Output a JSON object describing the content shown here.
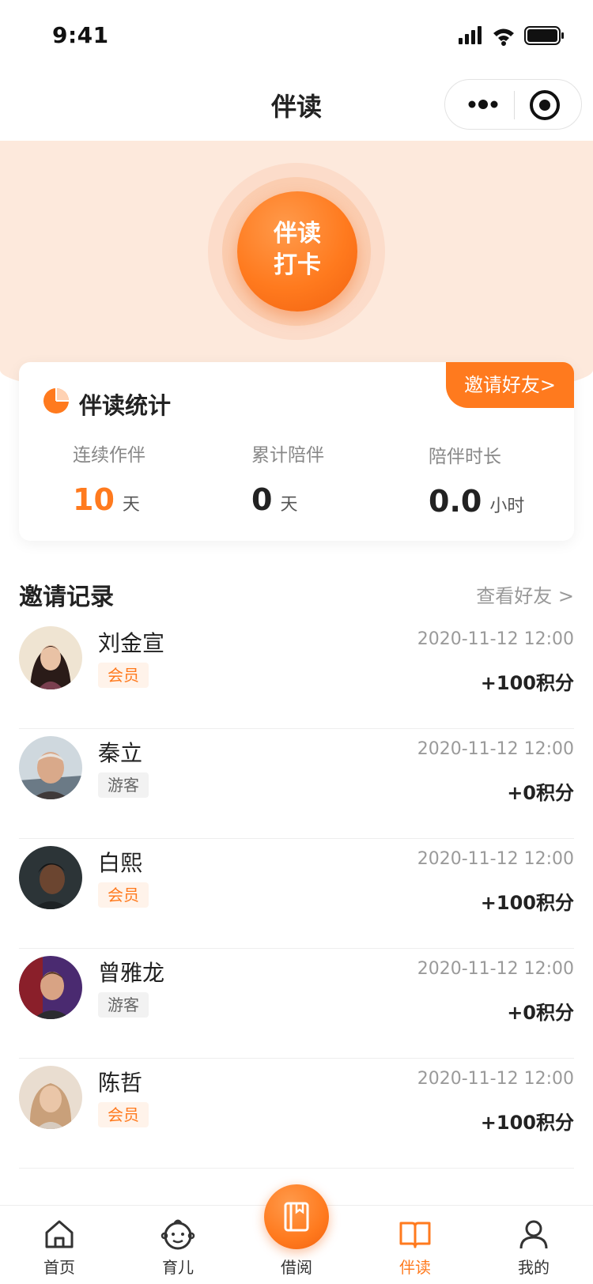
{
  "status_bar": {
    "time": "9:41"
  },
  "nav": {
    "title": "伴读"
  },
  "checkin": {
    "line1": "伴读",
    "line2": "打卡"
  },
  "stats": {
    "title": "伴读统计",
    "invite_label": "邀请好友>",
    "items": [
      {
        "label": "连续作伴",
        "value": "10",
        "unit": "天"
      },
      {
        "label": "累计陪伴",
        "value": "0",
        "unit": "天"
      },
      {
        "label": "陪伴时长",
        "value": "0.0",
        "unit": "小时"
      }
    ]
  },
  "records": {
    "title": "邀请记录",
    "link": "查看好友 >",
    "items": [
      {
        "name": "刘金宣",
        "badge": "会员",
        "badge_type": "member",
        "time": "2020-11-12 12:00",
        "points": "+100积分"
      },
      {
        "name": "秦立",
        "badge": "游客",
        "badge_type": "guest",
        "time": "2020-11-12 12:00",
        "points": "+0积分"
      },
      {
        "name": "白熙",
        "badge": "会员",
        "badge_type": "member",
        "time": "2020-11-12 12:00",
        "points": "+100积分"
      },
      {
        "name": "曾雅龙",
        "badge": "游客",
        "badge_type": "guest",
        "time": "2020-11-12 12:00",
        "points": "+0积分"
      },
      {
        "name": "陈哲",
        "badge": "会员",
        "badge_type": "member",
        "time": "2020-11-12 12:00",
        "points": "+100积分"
      }
    ]
  },
  "tabbar": {
    "items": [
      {
        "label": "首页",
        "icon": "home-icon"
      },
      {
        "label": "育儿",
        "icon": "baby-icon"
      },
      {
        "label": "借阅",
        "icon": "book-icon"
      },
      {
        "label": "伴读",
        "icon": "open-book-icon"
      },
      {
        "label": "我的",
        "icon": "user-icon"
      }
    ],
    "active": "伴读"
  },
  "colors": {
    "accent": "#ff7a1e",
    "hero_bg": "#fde9dc"
  }
}
